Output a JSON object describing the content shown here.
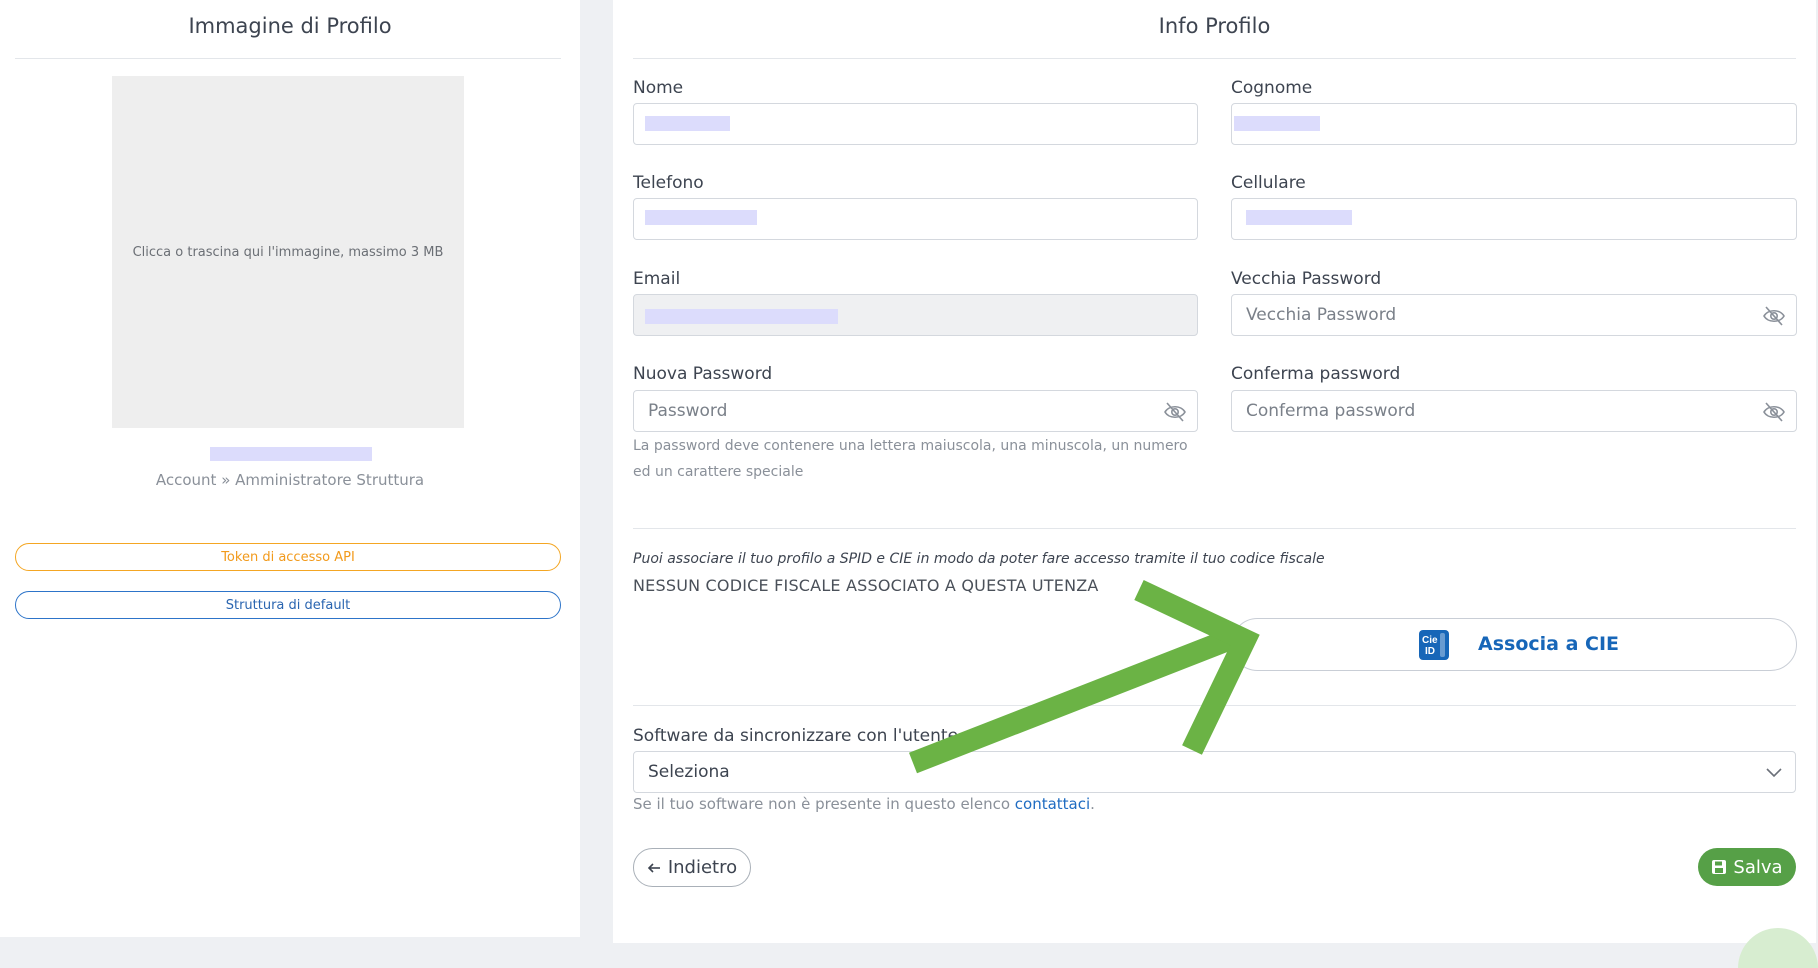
{
  "left_panel": {
    "title": "Immagine di Profilo",
    "upload_hint": "Clicca o trascina qui l'immagine, massimo 3 MB",
    "role": "Account » Amministratore Struttura",
    "token_button": "Token di accesso API",
    "default_button": "Struttura di default"
  },
  "right_panel": {
    "title": "Info Profilo",
    "fields": {
      "nome": {
        "label": "Nome",
        "value": ""
      },
      "cognome": {
        "label": "Cognome",
        "value": ""
      },
      "telefono": {
        "label": "Telefono",
        "value": ""
      },
      "cellulare": {
        "label": "Cellulare",
        "value": ""
      },
      "email": {
        "label": "Email",
        "value": ""
      },
      "old_password": {
        "label": "Vecchia Password",
        "placeholder": "Vecchia Password"
      },
      "new_password": {
        "label": "Nuova Password",
        "placeholder": "Password"
      },
      "confirm_password": {
        "label": "Conferma password",
        "placeholder": "Conferma password"
      }
    },
    "password_hint_line1": "La password deve contenere una lettera maiuscola, una minuscola, un numero",
    "password_hint_line2": "ed un carattere speciale",
    "spid_note": "Puoi associare il tuo profilo a SPID e CIE in modo da poter fare accesso tramite il tuo codice fiscale",
    "no_fiscal_code": "NESSUN CODICE FISCALE ASSOCIATO A QUESTA UTENZA",
    "cie_button": "Associa a CIE",
    "cie_logo_text_top": "Cie",
    "cie_logo_text_bottom": "ID",
    "software_label": "Software da sincronizzare con l'utente",
    "software_select_value": "Seleziona",
    "software_hint_prefix": "Se il tuo software non è presente in questo elenco ",
    "software_hint_link": "contattaci",
    "software_hint_suffix": ".",
    "back_button": "Indietro",
    "save_button": "Salva"
  },
  "colors": {
    "accent_orange": "#f4a623",
    "accent_blue": "#2d74c9",
    "save_green": "#56a047",
    "annotation_arrow": "#6bb345",
    "cie_blue": "#1766b8"
  },
  "icons": [
    "eye-slash-icon",
    "cie-logo-icon",
    "chevron-down-icon",
    "arrow-left-icon",
    "floppy-disk-icon"
  ]
}
